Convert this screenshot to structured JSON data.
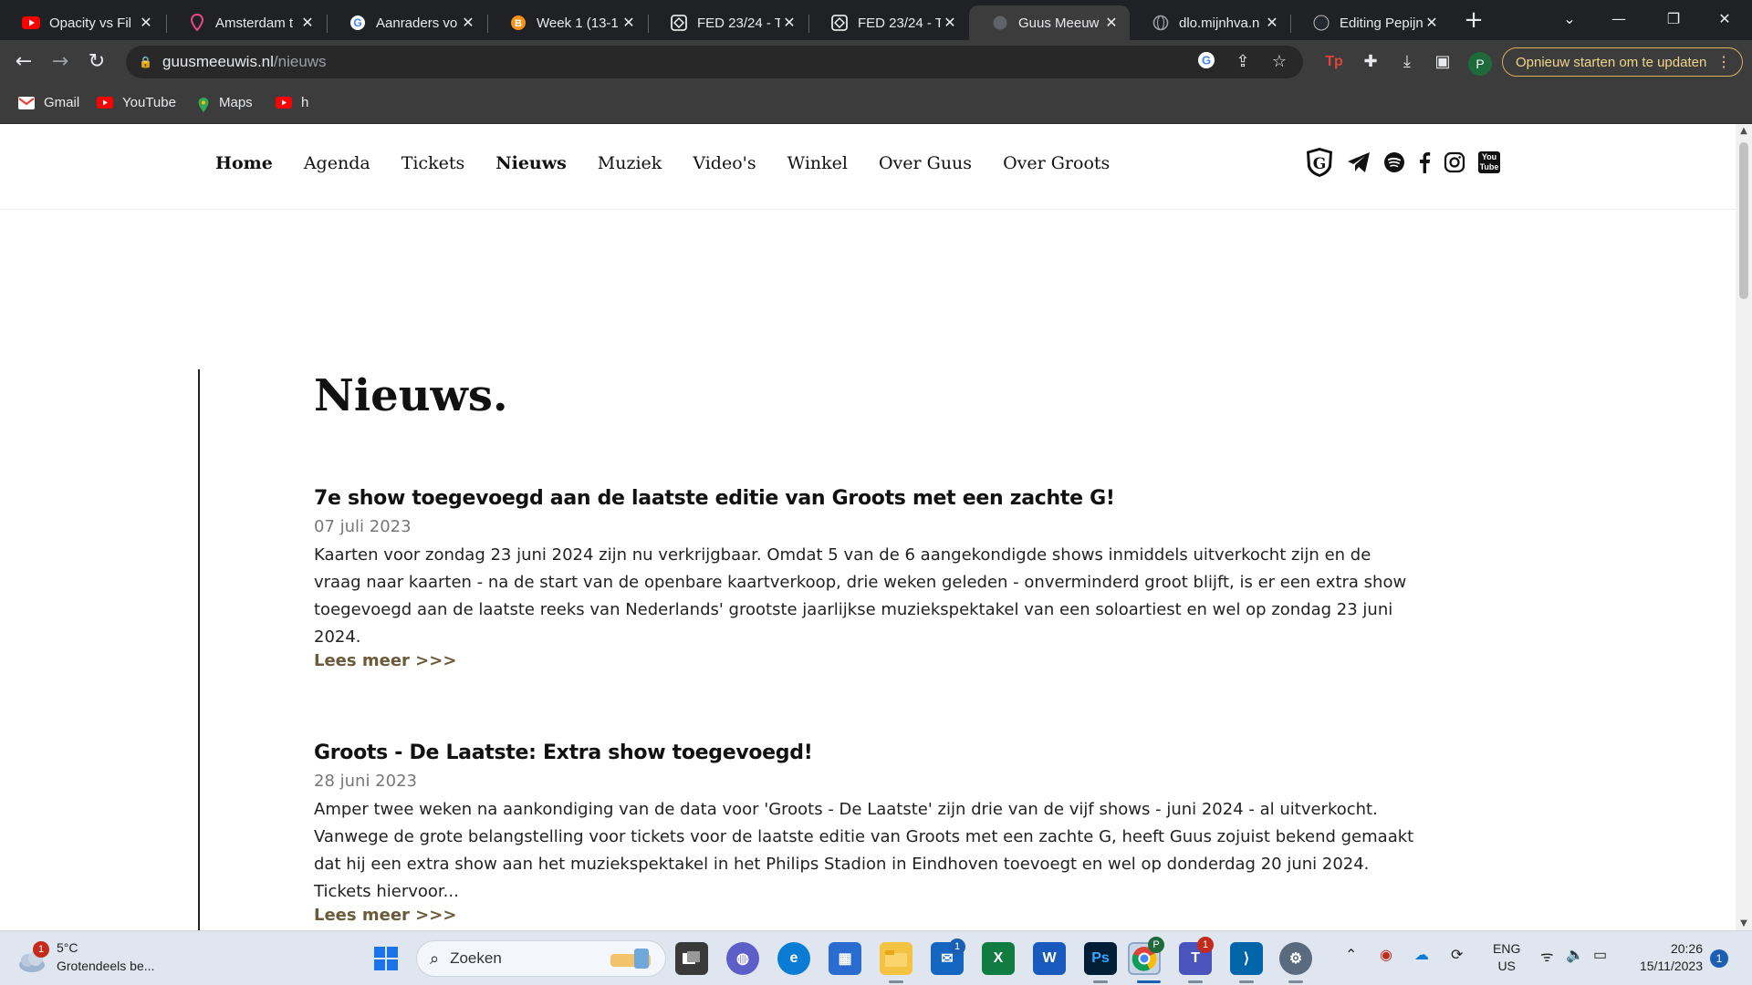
{
  "browser": {
    "tabs": [
      {
        "title": "Opacity vs Fil",
        "favicon": "youtube-icon",
        "active": false
      },
      {
        "title": "Amsterdam t",
        "favicon": "pin-icon",
        "active": false
      },
      {
        "title": "Aanraders vo",
        "favicon": "google-icon",
        "active": false
      },
      {
        "title": "Week 1 (13-1",
        "favicon": "bitcoin-like-icon",
        "active": false
      },
      {
        "title": "FED 23/24 - T",
        "favicon": "codepen-icon",
        "active": false
      },
      {
        "title": "FED 23/24 - T",
        "favicon": "codepen-icon",
        "active": false
      },
      {
        "title": "Guus Meeuw",
        "favicon": "globe-icon",
        "active": true
      },
      {
        "title": "dlo.mijnhva.n",
        "favicon": "globe-icon",
        "active": false
      },
      {
        "title": "Editing Pepijn",
        "favicon": "github-icon",
        "active": false
      }
    ],
    "url_host": "guusmeeuwis.nl",
    "url_path": "/nieuws",
    "update_button": "Opnieuw starten om te updaten",
    "profile_initial": "P",
    "bookmarks": [
      {
        "label": "Gmail",
        "icon": "gmail-icon"
      },
      {
        "label": "YouTube",
        "icon": "youtube-icon"
      },
      {
        "label": "Maps",
        "icon": "maps-icon"
      },
      {
        "label": "h",
        "icon": "youtube-icon"
      }
    ]
  },
  "site": {
    "menu": [
      "Home",
      "Agenda",
      "Tickets",
      "Nieuws",
      "Muziek",
      "Video's",
      "Winkel",
      "Over Guus",
      "Over Groots"
    ],
    "menu_active": [
      "Home",
      "Nieuws"
    ],
    "social_icons": [
      "guus-logo-icon",
      "telegram-icon",
      "spotify-icon",
      "facebook-icon",
      "instagram-icon",
      "youtube-icon"
    ],
    "social_youtube_text": "You Tube",
    "title": "Nieuws.",
    "articles": [
      {
        "title": "7e show toegevoegd aan de laatste editie van Groots met een zachte G!",
        "date": "07 juli 2023",
        "body": "Kaarten voor zondag 23 juni 2024 zijn nu verkrijgbaar. Omdat 5 van de 6 aangekondigde shows inmiddels uitverkocht zijn en de vraag naar kaarten - na de start van de openbare kaartverkoop, drie weken geleden - onverminderd groot blijft, is er een extra show toegevoegd aan de laatste reeks van Nederlands' grootste jaarlijkse muziekspektakel van een soloartiest en wel op zondag 23 juni 2024.",
        "more": "Lees meer >>>"
      },
      {
        "title": "Groots - De Laatste: Extra show toegevoegd!",
        "date": "28 juni 2023",
        "body": "Amper twee weken na aankondiging van de data voor 'Groots - De Laatste' zijn drie van de vijf shows - juni 2024 - al uitverkocht. Vanwege de grote belangstelling voor tickets voor de laatste editie van Groots met een zachte G, heeft Guus zojuist bekend gemaakt dat hij een extra show aan het muziekspektakel in het Philips Stadion in Eindhoven toevoegt en wel op donderdag 20 juni 2024. Tickets hiervoor...",
        "more": "Lees meer >>>"
      }
    ]
  },
  "taskbar": {
    "weather_temp": "5°C",
    "weather_desc": "Grotendeels be...",
    "weather_badge": "1",
    "search_placeholder": "Zoeken",
    "mail_badge": "1",
    "teams_badge": "1",
    "chrome_profile": "P",
    "lang_top": "ENG",
    "lang_bottom": "US",
    "time": "20:26",
    "date": "15/11/2023",
    "notifications": "1"
  },
  "colors": {
    "tabbar": "#202124",
    "toolbar": "#3c3c3c",
    "update_accent": "#f1d58a",
    "link_brown": "#6d5a3a"
  }
}
